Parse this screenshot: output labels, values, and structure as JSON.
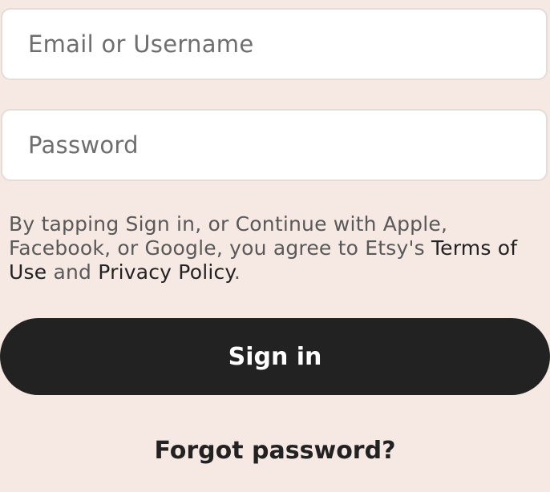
{
  "form": {
    "email_placeholder": "Email or Username",
    "email_value": "",
    "password_placeholder": "Password",
    "password_value": ""
  },
  "legal": {
    "text_part1": "By tapping Sign in, or Continue with Apple, Facebook, or Google, you agree to Etsy's ",
    "terms_link": "Terms of Use",
    "text_part2": " and ",
    "privacy_link": "Privacy Policy",
    "text_part3": "."
  },
  "actions": {
    "sign_in_label": "Sign in",
    "forgot_password_label": "Forgot password?"
  },
  "colors": {
    "background": "#f6e9e3",
    "primary_button": "#222222",
    "input_background": "#ffffff"
  }
}
